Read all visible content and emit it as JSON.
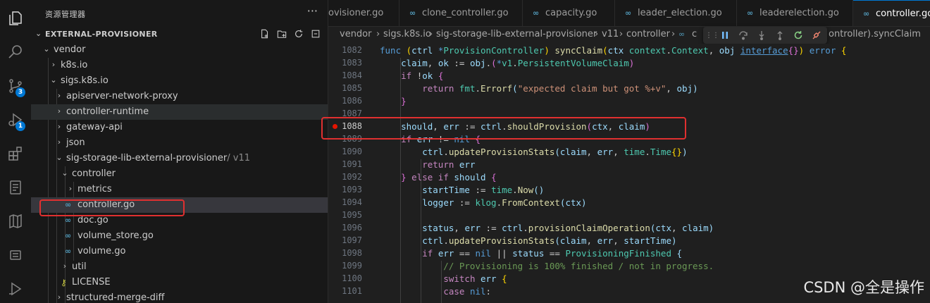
{
  "colors": {
    "accent": "#0078d4",
    "highlight_box": "#e03030",
    "breakpoint": "#e51400",
    "go_icon": "#519aba"
  },
  "activity_bar": {
    "items": [
      {
        "icon": "files-icon"
      },
      {
        "icon": "search-icon"
      },
      {
        "icon": "source-control-icon",
        "badge": "3"
      },
      {
        "icon": "run-debug-icon",
        "badge": "1"
      },
      {
        "icon": "extensions-icon"
      },
      {
        "icon": "remote-explorer-icon"
      },
      {
        "icon": "testing-icon"
      },
      {
        "icon": "output-icon"
      },
      {
        "icon": "deploy-icon"
      }
    ]
  },
  "sidebar": {
    "title": "资源管理器",
    "more": "···",
    "section": "EXTERNAL-PROVISIONER",
    "tree": [
      {
        "label": "vendor",
        "type": "folder",
        "open": true,
        "depth": 1
      },
      {
        "label": "k8s.io",
        "type": "folder",
        "open": false,
        "depth": 2
      },
      {
        "label": "sigs.k8s.io",
        "type": "folder",
        "open": true,
        "depth": 2
      },
      {
        "label": "apiserver-network-proxy",
        "type": "folder",
        "open": false,
        "depth": 3
      },
      {
        "label": "controller-runtime",
        "type": "folder",
        "open": false,
        "depth": 3
      },
      {
        "label": "gateway-api",
        "type": "folder",
        "open": false,
        "depth": 3
      },
      {
        "label": "json",
        "type": "folder",
        "open": false,
        "depth": 3
      },
      {
        "label": "sig-storage-lib-external-provisioner",
        "suffix": "/ v11",
        "type": "folder",
        "open": true,
        "depth": 3
      },
      {
        "label": "controller",
        "type": "folder",
        "open": true,
        "depth": 4
      },
      {
        "label": "metrics",
        "type": "folder",
        "open": false,
        "depth": 5
      },
      {
        "label": "controller.go",
        "type": "go",
        "depth": 5
      },
      {
        "label": "doc.go",
        "type": "go",
        "depth": 5
      },
      {
        "label": "volume_store.go",
        "type": "go",
        "depth": 5
      },
      {
        "label": "volume.go",
        "type": "go",
        "depth": 5
      },
      {
        "label": "util",
        "type": "folder",
        "open": false,
        "depth": 4
      },
      {
        "label": "LICENSE",
        "type": "license",
        "depth": 4
      },
      {
        "label": "structured-merge-diff",
        "type": "folder",
        "open": false,
        "depth": 3
      }
    ]
  },
  "tabs": [
    {
      "label": "ovisioner.go"
    },
    {
      "label": "clone_controller.go"
    },
    {
      "label": "capacity.go"
    },
    {
      "label": "leader_election.go"
    },
    {
      "label": "leaderelection.go"
    },
    {
      "label": "controller.go",
      "active": true
    }
  ],
  "breadcrumb": {
    "items": [
      "vendor",
      "sigs.k8s.io",
      "sig-storage-lib-external-provisioner",
      "v11",
      "controller",
      "c"
    ],
    "tail": "ontroller).syncClaim"
  },
  "code": {
    "lines": [
      {
        "n": "1082",
        "t": "func (ctrl *ProvisionController) syncClaim(ctx context.Context, obj interface{}) error {"
      },
      {
        "n": "1083",
        "t": "    claim, ok := obj.(*v1.PersistentVolumeClaim)"
      },
      {
        "n": "1084",
        "t": "    if !ok {"
      },
      {
        "n": "1085",
        "t": "        return fmt.Errorf(\"expected claim but got %+v\", obj)"
      },
      {
        "n": "1086",
        "t": "    }"
      },
      {
        "n": "1087",
        "t": ""
      },
      {
        "n": "1088",
        "t": "    should, err := ctrl.shouldProvision(ctx, claim)",
        "breakpoint": true
      },
      {
        "n": "1089",
        "t": "    if err != nil {"
      },
      {
        "n": "1090",
        "t": "        ctrl.updateProvisionStats(claim, err, time.Time{})"
      },
      {
        "n": "1091",
        "t": "        return err"
      },
      {
        "n": "1092",
        "t": "    } else if should {"
      },
      {
        "n": "1093",
        "t": "        startTime := time.Now()"
      },
      {
        "n": "1094",
        "t": "        logger := klog.FromContext(ctx)"
      },
      {
        "n": "1095",
        "t": ""
      },
      {
        "n": "1096",
        "t": "        status, err := ctrl.provisionClaimOperation(ctx, claim)"
      },
      {
        "n": "1097",
        "t": "        ctrl.updateProvisionStats(claim, err, startTime)"
      },
      {
        "n": "1098",
        "t": "        if err == nil || status == ProvisioningFinished {"
      },
      {
        "n": "1099",
        "t": "            // Provisioning is 100% finished / not in progress."
      },
      {
        "n": "1100",
        "t": "            switch err {"
      },
      {
        "n": "1101",
        "t": "            case nil:"
      }
    ]
  },
  "watermark": "CSDN @全是操作"
}
